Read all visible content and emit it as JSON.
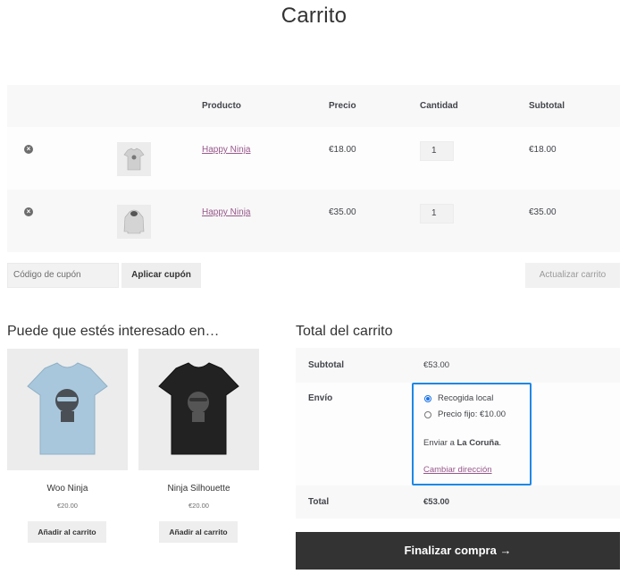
{
  "page": {
    "title": "Carrito"
  },
  "cart": {
    "headers": {
      "product": "Producto",
      "price": "Precio",
      "quantity": "Cantidad",
      "subtotal": "Subtotal"
    },
    "rows": [
      {
        "name": "Happy Ninja",
        "price": "€18.00",
        "quantity": "1",
        "subtotal": "€18.00",
        "thumb_icon": "tshirt-icon"
      },
      {
        "name": "Happy Ninja",
        "price": "€35.00",
        "quantity": "1",
        "subtotal": "€35.00",
        "thumb_icon": "hoodie-icon"
      }
    ],
    "remove_icon": "remove-circle-icon"
  },
  "actions": {
    "coupon_placeholder": "Código de cupón",
    "apply_coupon": "Aplicar cupón",
    "update_cart": "Actualizar carrito"
  },
  "cross_sells": {
    "heading": "Puede que estés interesado en…",
    "items": [
      {
        "name": "Woo Ninja",
        "price": "€20.00",
        "button": "Añadir al carrito",
        "image_icon": "light-blue-tshirt-icon"
      },
      {
        "name": "Ninja Silhouette",
        "price": "€20.00",
        "button": "Añadir al carrito",
        "image_icon": "black-tshirt-icon"
      }
    ]
  },
  "totals": {
    "heading": "Total del carrito",
    "subtotal_label": "Subtotal",
    "subtotal_value": "€53.00",
    "shipping_label": "Envío",
    "shipping_options": [
      {
        "label": "Recogida local",
        "selected": true
      },
      {
        "label": "Precio fijo: €10.00",
        "selected": false
      }
    ],
    "ship_to_prefix": "Enviar a",
    "ship_to_place": "La Coruña",
    "ship_to_suffix": ".",
    "change_address": "Cambiar dirección",
    "total_label": "Total",
    "total_value": "€53.00",
    "checkout_label": "Finalizar compra",
    "checkout_arrow": "→"
  },
  "colors": {
    "accent_link": "#96588a",
    "highlight_box": "#1e88e5",
    "checkout_bg": "#333333"
  }
}
